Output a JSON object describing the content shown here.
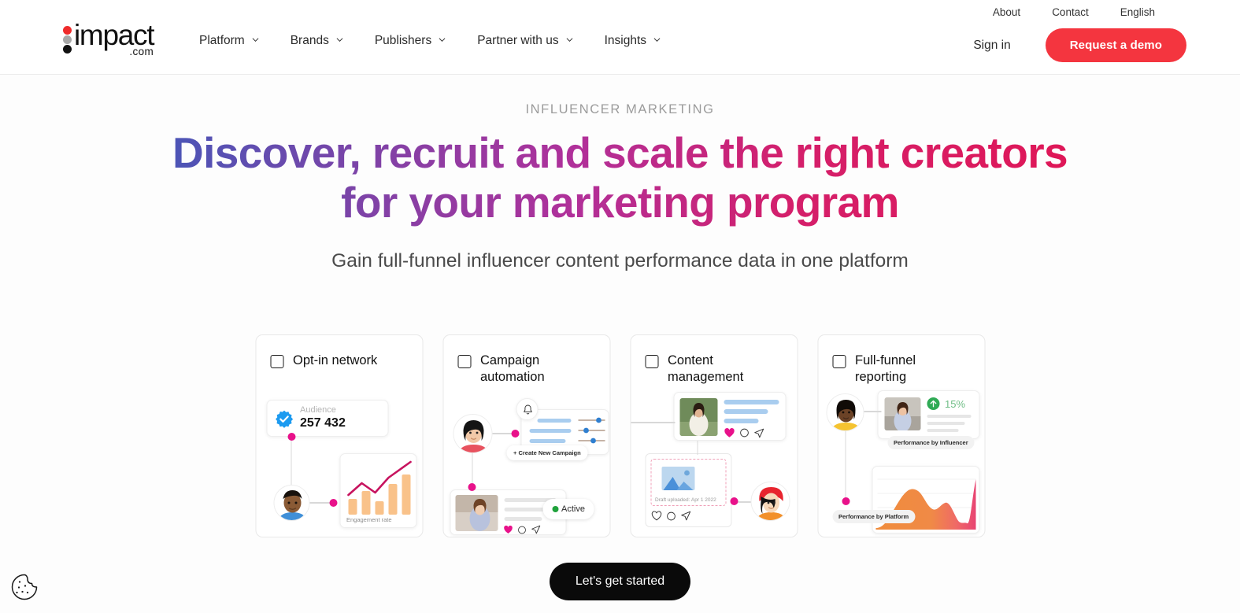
{
  "brand": {
    "logo_word": "impact",
    "logo_tld": ".com",
    "accent_red": "#f4353f",
    "accent_pink": "#e8118a",
    "accent_black": "#0a0a0a"
  },
  "utility_nav": [
    {
      "label": "About"
    },
    {
      "label": "Contact"
    },
    {
      "label": "English"
    }
  ],
  "main_nav": [
    {
      "label": "Platform"
    },
    {
      "label": "Brands"
    },
    {
      "label": "Publishers"
    },
    {
      "label": "Partner with us"
    },
    {
      "label": "Insights"
    }
  ],
  "header_actions": {
    "signin_label": "Sign in",
    "demo_label": "Request a demo"
  },
  "hero": {
    "eyebrow": "INFLUENCER MARKETING",
    "headline": "Discover, recruit and scale the right creators for your marketing program",
    "subhead": "Gain full-funnel influencer content performance data in one platform",
    "cta_label": "Let's get started"
  },
  "cards": [
    {
      "title": "Opt-in network",
      "checked": false,
      "art": {
        "audience_label": "Audience",
        "audience_value": "257 432",
        "chart_label": "Engagement rate",
        "chart_type": "bar",
        "bar_values": [
          28,
          48,
          24,
          64,
          88
        ],
        "trend_line": [
          35,
          58,
          44,
          70,
          96
        ]
      }
    },
    {
      "title": "Campaign automation",
      "checked": false,
      "art": {
        "create_campaign_label": "+ Create New Campaign",
        "status_label": "Active",
        "status_color": "#20a23c"
      }
    },
    {
      "title": "Content management",
      "checked": false,
      "art": {
        "draft_label": "Draft uploaded: Apr 1 2022"
      }
    },
    {
      "title": "Full-funnel reporting",
      "checked": false,
      "art": {
        "metric_value": "15%",
        "metric_color": "#2faa55",
        "label_influencer": "Performance by Influencer",
        "label_platform": "Performance by Platform"
      }
    }
  ],
  "cookie": {
    "name": "cookie-consent"
  }
}
